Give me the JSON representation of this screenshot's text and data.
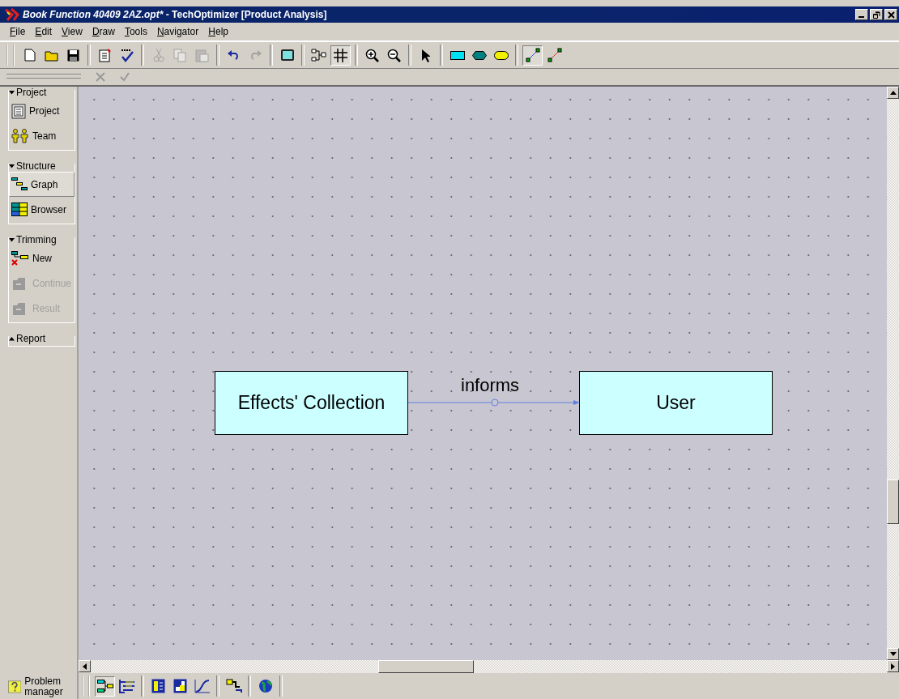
{
  "window": {
    "document": "Book Function 40409 2AZ.opt*",
    "app": " - TechOptimizer [Product Analysis]"
  },
  "menu": [
    "File",
    "Edit",
    "View",
    "Draw",
    "Tools",
    "Navigator",
    "Help"
  ],
  "toolbar_groups": [
    [
      {
        "kind": "new",
        "disabled": false,
        "selected": false
      },
      {
        "kind": "open",
        "disabled": false,
        "selected": false
      },
      {
        "kind": "save",
        "disabled": false,
        "selected": false
      }
    ],
    [
      {
        "kind": "properties",
        "disabled": false,
        "selected": false
      },
      {
        "kind": "spellcheck",
        "disabled": false,
        "selected": false
      }
    ],
    [
      {
        "kind": "cut",
        "disabled": true,
        "selected": false
      },
      {
        "kind": "copy",
        "disabled": true,
        "selected": false
      },
      {
        "kind": "paste",
        "disabled": true,
        "selected": false
      }
    ],
    [
      {
        "kind": "undo",
        "disabled": false,
        "selected": false
      },
      {
        "kind": "redo",
        "disabled": true,
        "selected": false
      }
    ],
    [
      {
        "kind": "frame",
        "disabled": false,
        "selected": false
      }
    ],
    [
      {
        "kind": "layout",
        "disabled": false,
        "selected": false
      },
      {
        "kind": "grid",
        "disabled": false,
        "selected": true
      }
    ],
    [
      {
        "kind": "zoomin",
        "disabled": false,
        "selected": false
      },
      {
        "kind": "zoomout",
        "disabled": false,
        "selected": false
      }
    ],
    [
      {
        "kind": "pointer",
        "disabled": false,
        "selected": false
      }
    ],
    [
      {
        "kind": "rectnode",
        "disabled": false,
        "selected": false
      },
      {
        "kind": "hexnode",
        "disabled": false,
        "selected": false
      },
      {
        "kind": "pillnode",
        "disabled": false,
        "selected": false
      }
    ],
    [
      {
        "kind": "useful",
        "disabled": false,
        "selected": true
      },
      {
        "kind": "harmful",
        "disabled": false,
        "selected": false
      }
    ]
  ],
  "sidebar": [
    {
      "title": "Project",
      "expanded": true,
      "items": [
        {
          "label": "Project",
          "kind": "clipboard",
          "selected": false,
          "disabled": false
        },
        {
          "label": "Team",
          "kind": "people",
          "selected": false,
          "disabled": false
        }
      ]
    },
    {
      "title": "Structure",
      "expanded": true,
      "items": [
        {
          "label": "Graph",
          "kind": "graph",
          "selected": true,
          "disabled": false
        },
        {
          "label": "Browser",
          "kind": "table",
          "selected": false,
          "disabled": false
        }
      ]
    },
    {
      "title": "Trimming",
      "expanded": true,
      "items": [
        {
          "label": "New",
          "kind": "trim",
          "selected": false,
          "disabled": false
        },
        {
          "label": "Continue",
          "kind": "box",
          "selected": false,
          "disabled": true
        },
        {
          "label": "Result",
          "kind": "box",
          "selected": false,
          "disabled": true
        }
      ]
    },
    {
      "title": "Report",
      "expanded": false
    }
  ],
  "problem_manager": {
    "label": "Problem manager"
  },
  "canvas": {
    "nodes": [
      {
        "label": "Effects' Collection"
      },
      {
        "label": "User"
      }
    ],
    "link": {
      "label": "informs"
    }
  },
  "bottom_toolbar_groups": [
    [
      {
        "kind": "graph",
        "selected": true
      },
      {
        "kind": "list",
        "selected": false
      }
    ],
    [
      {
        "kind": "panel",
        "selected": false
      },
      {
        "kind": "square",
        "selected": false
      },
      {
        "kind": "curve",
        "selected": false
      }
    ],
    [
      {
        "kind": "steps",
        "selected": false
      }
    ],
    [
      {
        "kind": "globe",
        "selected": false
      }
    ]
  ]
}
